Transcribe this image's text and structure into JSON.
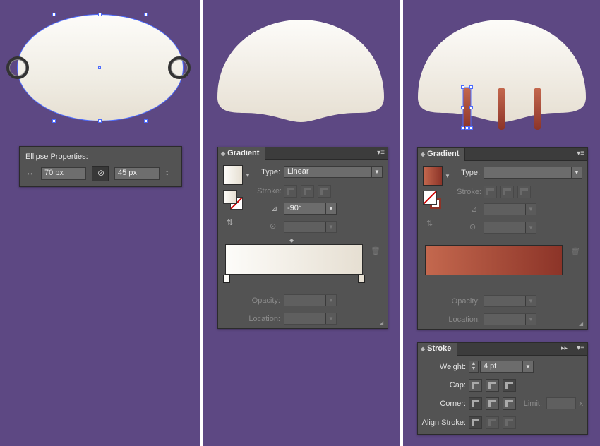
{
  "ellipse_properties": {
    "title": "Ellipse Properties:",
    "width_value": "70 px",
    "height_value": "45 px"
  },
  "gradient_panel_1": {
    "tab_label": "Gradient",
    "type_label": "Type:",
    "type_value": "Linear",
    "stroke_label": "Stroke:",
    "angle_value": "-90°",
    "opacity_label": "Opacity:",
    "location_label": "Location:"
  },
  "gradient_panel_2": {
    "tab_label": "Gradient",
    "type_label": "Type:",
    "type_value": "",
    "stroke_label": "Stroke:",
    "opacity_label": "Opacity:",
    "location_label": "Location:"
  },
  "stroke_panel": {
    "tab_label": "Stroke",
    "weight_label": "Weight:",
    "weight_value": "4 pt",
    "cap_label": "Cap:",
    "corner_label": "Corner:",
    "limit_label": "Limit:",
    "limit_suffix": "x",
    "align_label": "Align Stroke:"
  },
  "colors": {
    "background": "#5d4883",
    "cream_light": "#fdfcf9",
    "cream_dark": "#e6dfd2",
    "red_light": "#c4684e",
    "red_dark": "#8c3428",
    "selection_blue": "#4d6cff"
  }
}
